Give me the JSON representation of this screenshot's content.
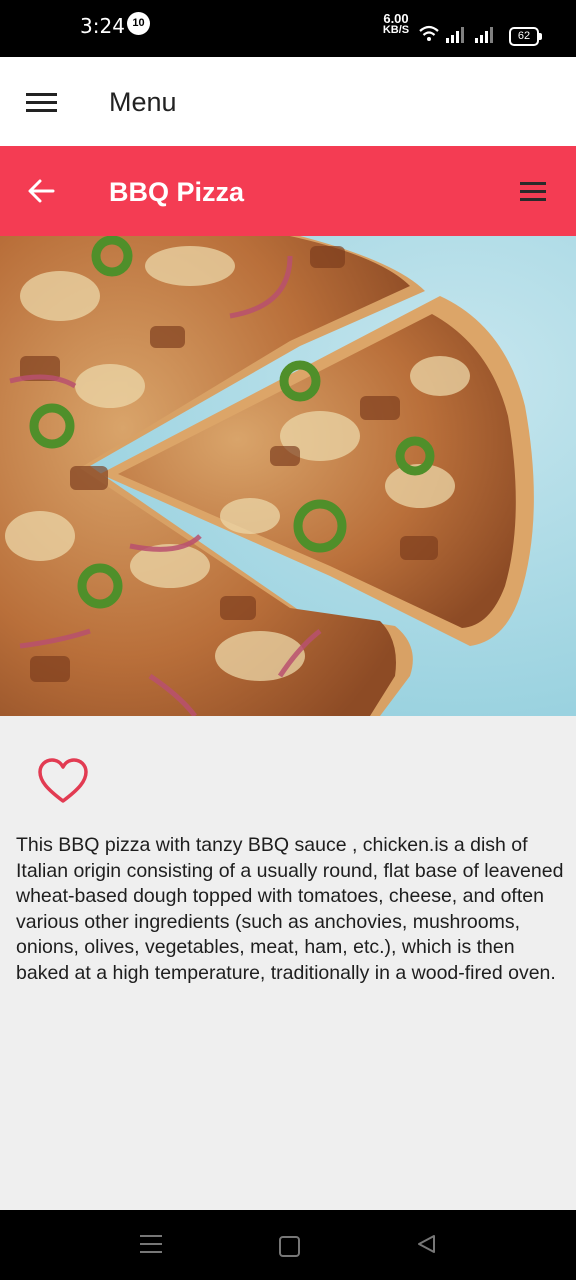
{
  "status": {
    "time": "3:24",
    "notification_count": "10",
    "speed_value": "6.00",
    "speed_unit": "KB/S",
    "battery": "62"
  },
  "menu_bar": {
    "title": "Menu"
  },
  "toolbar": {
    "title": "BBQ Pizza",
    "accent_color": "#f43c53"
  },
  "hero": {
    "icon": "pizza-photo"
  },
  "favorite": {
    "icon": "heart-outline-icon",
    "color": "#e23b52"
  },
  "description": "This BBQ pizza with tanzy BBQ sauce , chicken.is a dish of Italian origin consisting of a usually round, flat base of leavened wheat-based dough topped with tomatoes, cheese, and often various other ingredients (such as anchovies, mushrooms, onions, olives, vegetables, meat, ham, etc.), which is then baked at a high temperature, traditionally in a wood-fired oven."
}
